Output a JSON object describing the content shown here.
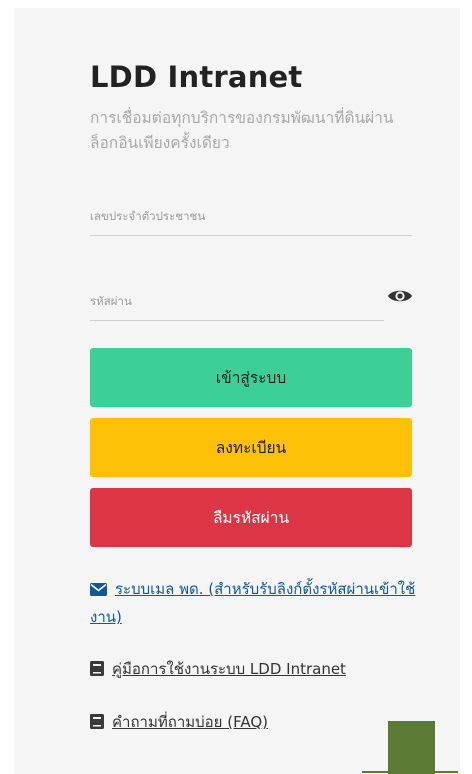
{
  "app": {
    "title": "LDD Intranet",
    "subtitle": "การเชื่อมต่อทุกบริการของกรมพัฒนาที่ดินผ่านล็อกอินเพียงครั้งเดียว"
  },
  "form": {
    "id_placeholder": "เลขประจำตัวประชาชน",
    "password_placeholder": "รหัสผ่าน",
    "show_password_icon": "eye-icon"
  },
  "buttons": {
    "login": "เข้าสู่ระบบ",
    "register": "ลงทะเบียน",
    "forgot": "ลืมรหัสผ่าน"
  },
  "links": {
    "mail": "ระบบเมล พด. (สำหรับรับลิงก์ตั้งรหัสผ่านเข้าใช้งาน)",
    "manual": "คู่มือการใช้งานระบบ LDD Intranet",
    "faq": "คำถามที่ถามบ่อย (FAQ)"
  },
  "colors": {
    "login": "#3ccf98",
    "register": "#ffc107",
    "forgot": "#dc3545",
    "link": "#0e5a97",
    "accent_block": "#5b7b34"
  }
}
